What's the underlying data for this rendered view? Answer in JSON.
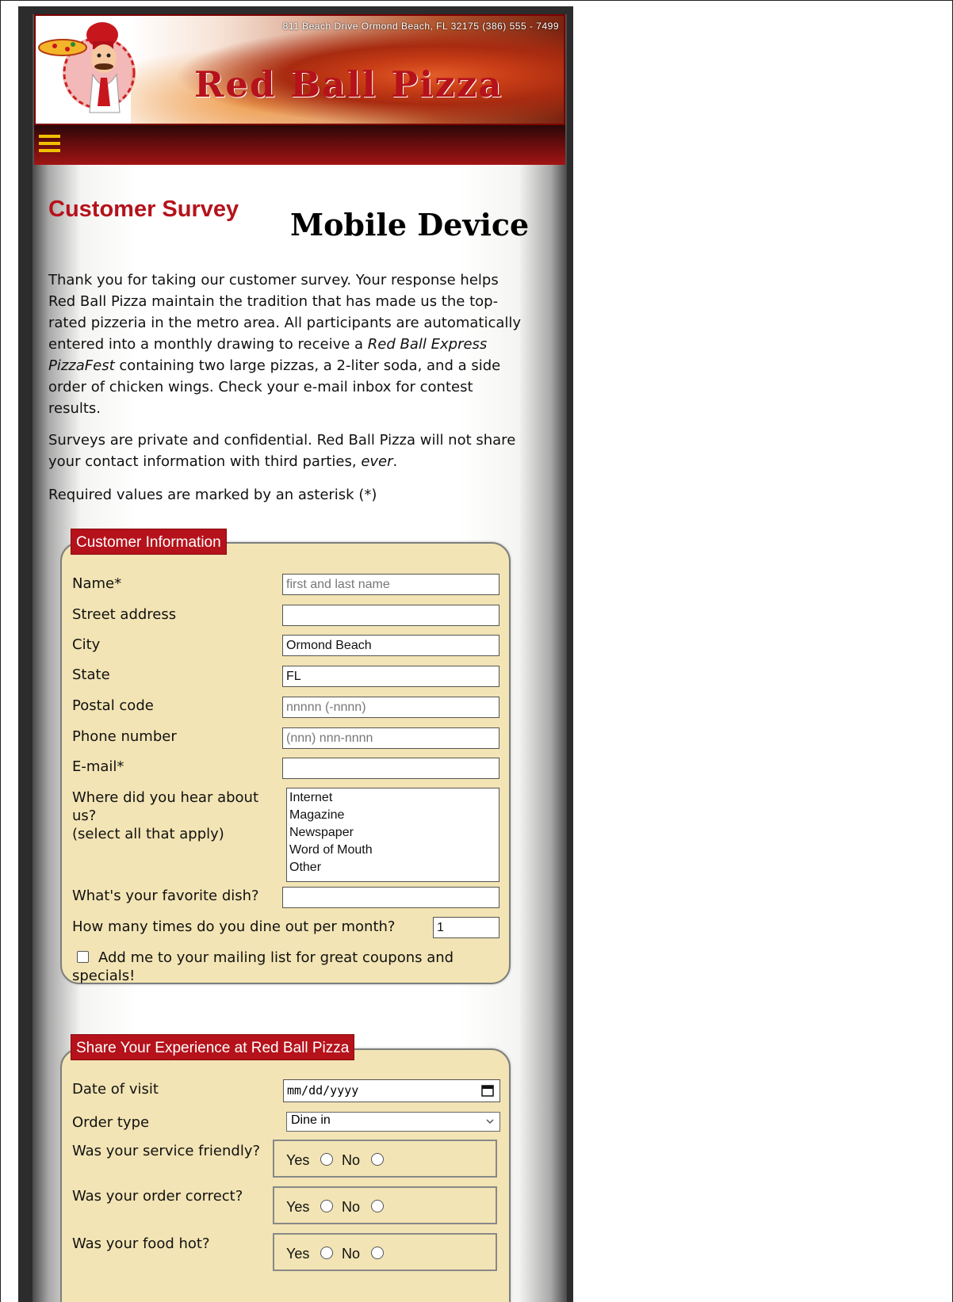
{
  "header": {
    "address": "811 Beach Drive  Ormond Beach, FL  32175   (386) 555 - 7499",
    "title": "Red Ball Pizza"
  },
  "nav": {
    "menu_icon": "hamburger-menu-icon"
  },
  "heading": "Customer Survey",
  "subheading": "Mobile Device",
  "intro": {
    "text1": "Thank you for taking our customer survey. Your response helps Red Ball Pizza maintain the tradition that has made us the top-rated pizzeria in the metro area. All participants are automatically entered into a monthly drawing to receive a ",
    "prize": "Red Ball Express PizzaFest",
    "text2": " containing two large pizzas, a 2-liter soda, and a side order of chicken wings. Check your e-mail inbox for contest results."
  },
  "privacy": {
    "text": "Surveys are private and confidential. Red Ball Pizza will not share your contact information with third parties, ",
    "emph": "ever",
    "end": "."
  },
  "required_note": "Required values are marked by an asterisk (*)",
  "customer_info": {
    "legend": "Customer Information",
    "name_label": "Name*",
    "name_placeholder": "first and last name",
    "street_label": "Street address",
    "city_label": "City",
    "city_value": "Ormond Beach",
    "state_label": "State",
    "state_value": "FL",
    "postal_label": "Postal code",
    "postal_placeholder": "nnnnn (-nnnn)",
    "phone_label": "Phone number",
    "phone_placeholder": "(nnn) nnn-nnnn",
    "email_label": "E-mail*",
    "hear_label_1": "Where did you hear about us?",
    "hear_label_2": "(select all that apply)",
    "hear_options": [
      "Internet",
      "Magazine",
      "Newspaper",
      "Word of Mouth",
      "Other"
    ],
    "dish_label": "What's your favorite dish?",
    "dine_label": "How many times do you dine out per month?",
    "dine_value": "1",
    "mailing_label": "Add me to your mailing list for great coupons and specials!"
  },
  "experience": {
    "legend": "Share Your Experience at Red Ball Pizza",
    "date_label": "Date of visit",
    "date_placeholder": "mm/dd/yyyy",
    "order_label": "Order type",
    "order_value": "Dine in",
    "questions": [
      {
        "label": "Was your service friendly?",
        "yes": "Yes",
        "no": "No"
      },
      {
        "label": "Was your order correct?",
        "yes": "Yes",
        "no": "No"
      },
      {
        "label": "Was your food hot?",
        "yes": "Yes",
        "no": "No"
      }
    ]
  },
  "colors": {
    "brand_red": "#b5121b",
    "fieldset_bg": "#f2e4b4",
    "menu_icon": "#f0c000"
  }
}
